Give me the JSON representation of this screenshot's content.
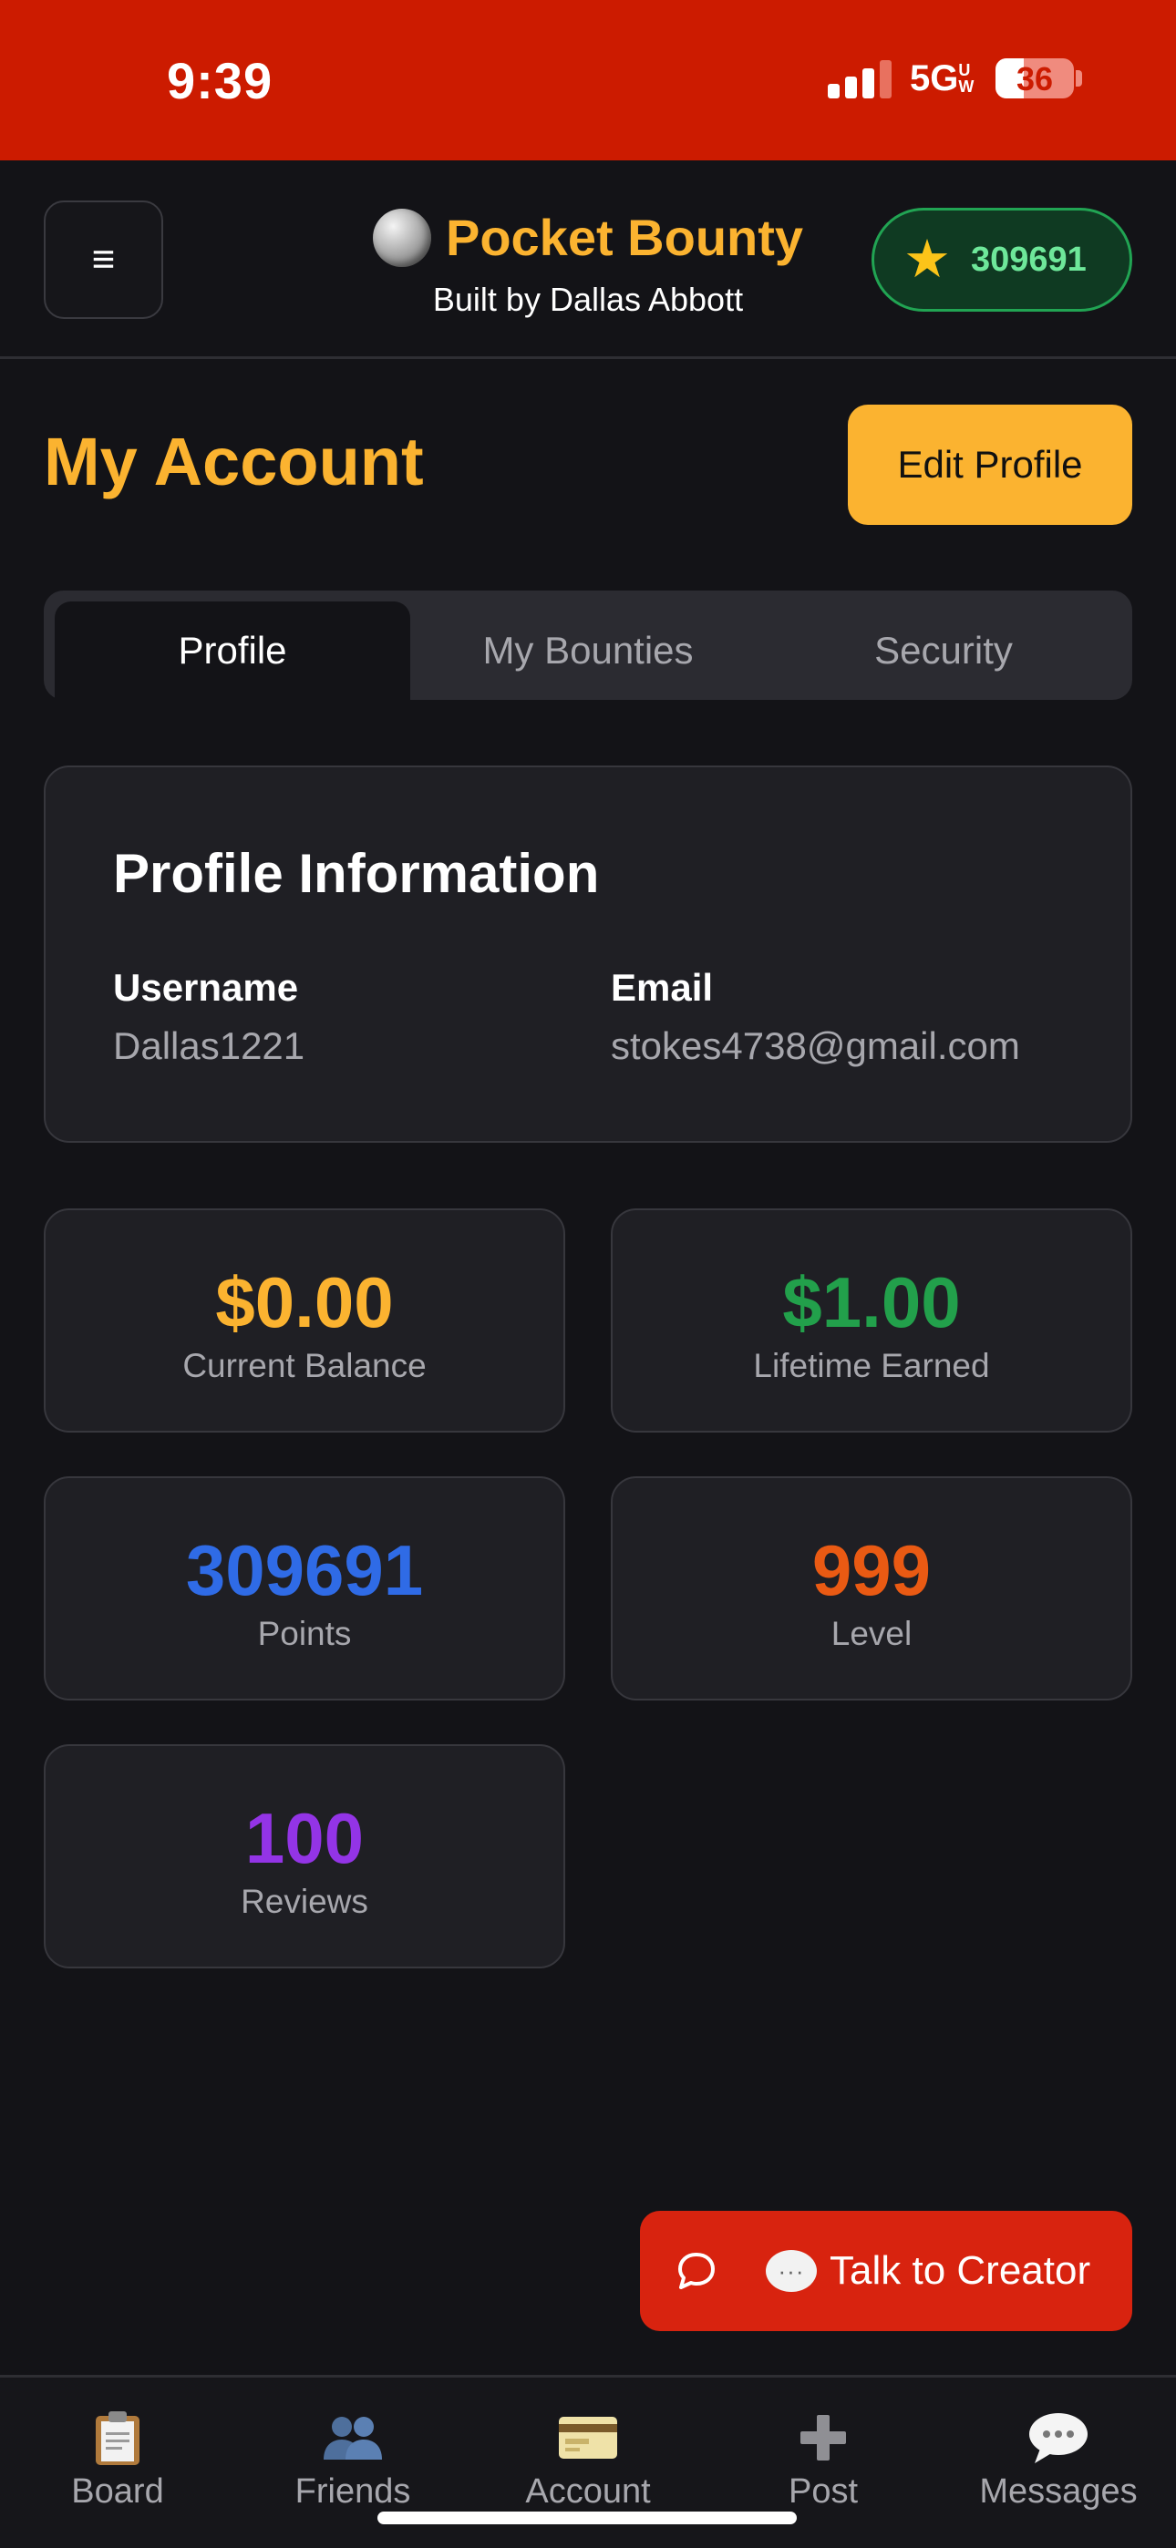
{
  "status_bar": {
    "time": "9:39",
    "network": "5G",
    "network_suffix": "UW",
    "battery": "36"
  },
  "header": {
    "app_title": "Pocket Bounty",
    "subtitle": "Built by Dallas Abbott",
    "menu_glyph": "≡",
    "points": "309691",
    "points_icon": "star-icon"
  },
  "page": {
    "title": "My Account",
    "edit_button": "Edit Profile"
  },
  "tabs": [
    {
      "label": "Profile",
      "active": true
    },
    {
      "label": "My Bounties",
      "active": false
    },
    {
      "label": "Security",
      "active": false
    }
  ],
  "profile": {
    "heading": "Profile Information",
    "username_label": "Username",
    "username_value": "Dallas1221",
    "email_label": "Email",
    "email_value": "stokes4738@gmail.com"
  },
  "stats": [
    {
      "value": "$0.00",
      "label": "Current Balance",
      "color": "#fbb330"
    },
    {
      "value": "$1.00",
      "label": "Lifetime Earned",
      "color": "#22a04b"
    },
    {
      "value": "309691",
      "label": "Points",
      "color": "#2f6be6"
    },
    {
      "value": "999",
      "label": "Level",
      "color": "#ea5a13"
    },
    {
      "value": "100",
      "label": "Reviews",
      "color": "#9334e6"
    }
  ],
  "talk_button": {
    "label": "Talk to Creator"
  },
  "nav": [
    {
      "label": "Board",
      "icon": "clipboard-icon"
    },
    {
      "label": "Friends",
      "icon": "people-icon"
    },
    {
      "label": "Account",
      "icon": "credit-card-icon"
    },
    {
      "label": "Post",
      "icon": "plus-icon"
    },
    {
      "label": "Messages",
      "icon": "speech-bubble-icon"
    }
  ],
  "colors": {
    "accent": "#fbb330",
    "status_bar": "#cc1b00",
    "background": "#131317",
    "card": "#1f1f24",
    "cta_red": "#d8230f"
  }
}
